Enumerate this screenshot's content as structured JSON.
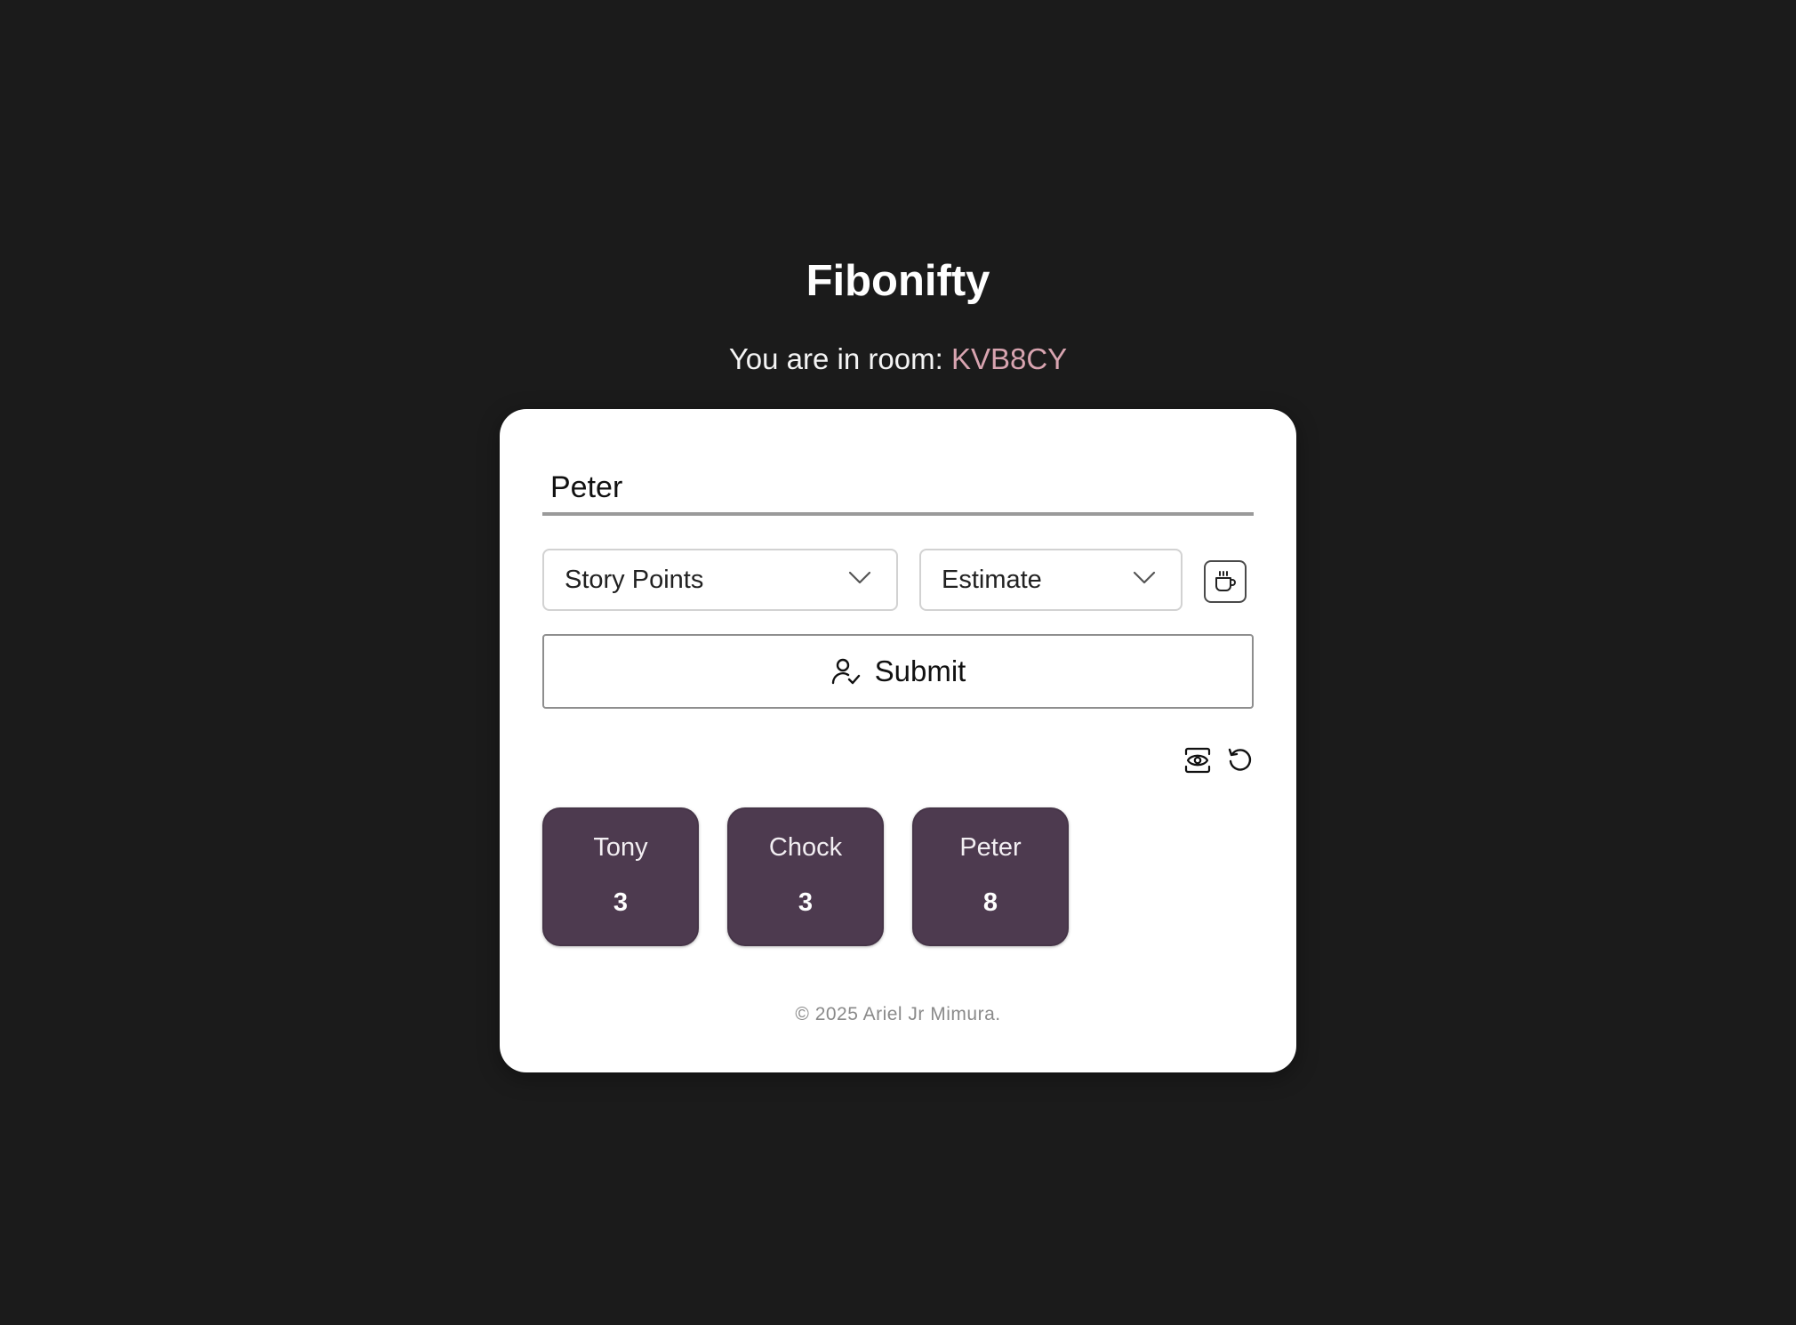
{
  "header": {
    "title": "Fibonifty",
    "room_prefix": "You are in room: ",
    "room_code": "KVB8CY"
  },
  "form": {
    "name_value": "Peter",
    "name_placeholder": "",
    "scale_select": {
      "selected": "Story Points",
      "icon": "chevron-down-icon"
    },
    "estimate_select": {
      "selected": "Estimate",
      "icon": "chevron-down-icon"
    },
    "coffee_button_icon": "coffee-cup-icon",
    "submit_label": "Submit",
    "submit_icon": "user-check-icon"
  },
  "controls": {
    "reveal_icon": "eye-icon",
    "reset_icon": "reset-icon"
  },
  "votes": [
    {
      "name": "Tony",
      "value": "3"
    },
    {
      "name": "Chock",
      "value": "3"
    },
    {
      "name": "Peter",
      "value": "8"
    }
  ],
  "footer": {
    "copyright": "© 2025 Ariel Jr Mimura."
  },
  "colors": {
    "background": "#1b1b1b",
    "card": "#ffffff",
    "vote_card": "#4d3a4f",
    "room_code": "#d8a4b0"
  }
}
